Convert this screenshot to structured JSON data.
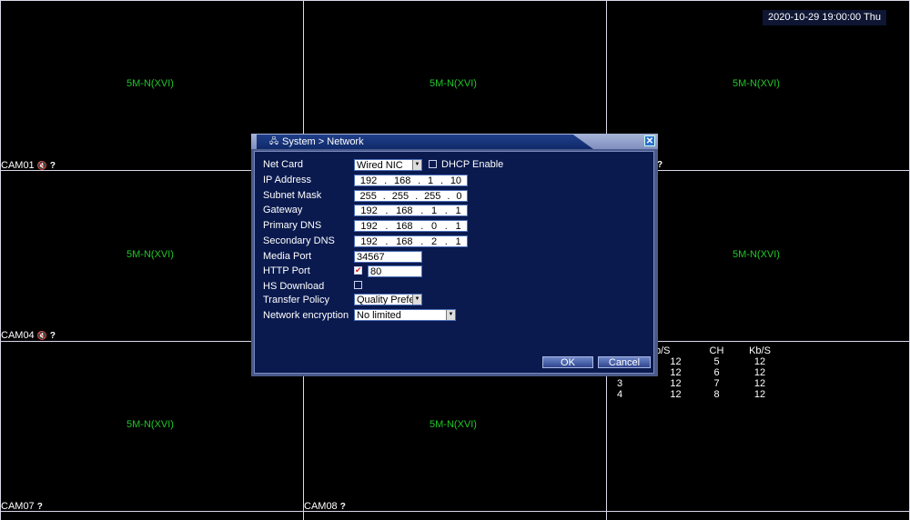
{
  "datetime": "2020-10-29 19:00:00 Thu",
  "cells": [
    {
      "label": "5M-N(XVI)"
    },
    {
      "label": "5M-N(XVI)"
    },
    {
      "label": "5M-N(XVI)"
    },
    {
      "label": "5M-N(XVI)"
    },
    {
      "label": "5M-N(XVI)"
    },
    {
      "label": "5M-N(XVI)"
    },
    {
      "label": "5M-N(XVI)"
    }
  ],
  "cams": {
    "cam01": "CAM01",
    "cam04": "CAM04",
    "cam07": "CAM07",
    "cam08": "CAM08",
    "q_mark": "?"
  },
  "stats": {
    "headers": [
      "b/S",
      "CH",
      "Kb/S"
    ],
    "rows": [
      [
        "",
        "12",
        "5",
        "12"
      ],
      [
        "",
        "12",
        "6",
        "12"
      ],
      [
        "3",
        "12",
        "7",
        "12"
      ],
      [
        "4",
        "12",
        "8",
        "12"
      ]
    ]
  },
  "dialog": {
    "title": "System > Network",
    "close": "✕",
    "net_card_label": "Net Card",
    "net_card_value": "Wired NIC",
    "dhcp_label": "DHCP Enable",
    "ip_label": "IP Address",
    "ip": [
      "192",
      "168",
      "1",
      "10"
    ],
    "subnet_label": "Subnet Mask",
    "subnet": [
      "255",
      "255",
      "255",
      "0"
    ],
    "gateway_label": "Gateway",
    "gateway": [
      "192",
      "168",
      "1",
      "1"
    ],
    "dns1_label": "Primary DNS",
    "dns1": [
      "192",
      "168",
      "0",
      "1"
    ],
    "dns2_label": "Secondary DNS",
    "dns2": [
      "192",
      "168",
      "2",
      "1"
    ],
    "media_port_label": "Media Port",
    "media_port": "34567",
    "http_port_label": "HTTP Port",
    "http_port": "80",
    "hs_download_label": "HS Download",
    "transfer_policy_label": "Transfer Policy",
    "transfer_policy_value": "Quality Prefe",
    "encryption_label": "Network encryption",
    "encryption_value": "No limited",
    "ok": "OK",
    "cancel": "Cancel"
  }
}
